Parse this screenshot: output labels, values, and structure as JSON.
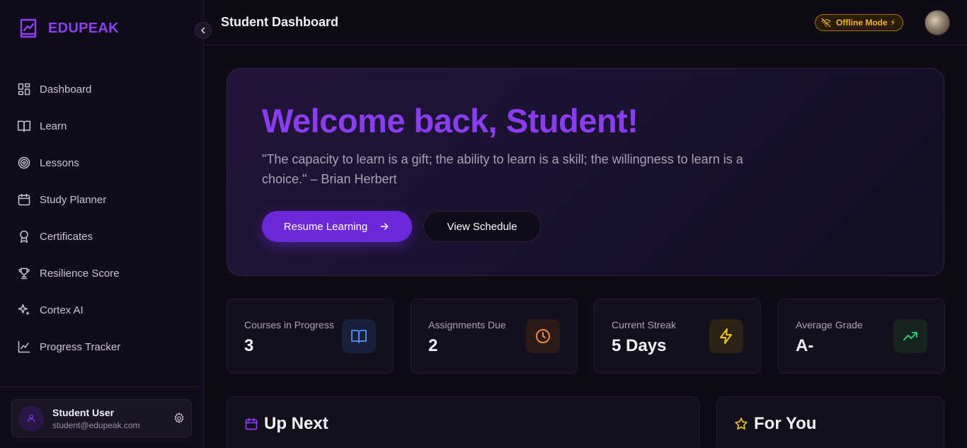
{
  "brand": {
    "name": "EDUPEAK"
  },
  "sidebar": {
    "items": [
      {
        "label": "Dashboard",
        "icon": "layout-dashboard-icon"
      },
      {
        "label": "Learn",
        "icon": "book-open-icon"
      },
      {
        "label": "Lessons",
        "icon": "target-icon"
      },
      {
        "label": "Study Planner",
        "icon": "calendar-icon"
      },
      {
        "label": "Certificates",
        "icon": "award-icon"
      },
      {
        "label": "Resilience Score",
        "icon": "trophy-icon"
      },
      {
        "label": "Cortex AI",
        "icon": "sparkles-icon"
      },
      {
        "label": "Progress Tracker",
        "icon": "line-chart-icon"
      }
    ],
    "user": {
      "name": "Student User",
      "email": "student@edupeak.com"
    }
  },
  "header": {
    "title": "Student Dashboard",
    "offline_label": "Offline Mode ⚡"
  },
  "hero": {
    "title": "Welcome back, Student!",
    "quote": "\"The capacity to learn is a gift; the ability to learn is a skill; the willingness to learn is a choice.\" – Brian Herbert",
    "primary_label": "Resume Learning",
    "secondary_label": "View Schedule"
  },
  "stats": [
    {
      "label": "Courses in Progress",
      "value": "3",
      "icon": "book-open-icon",
      "color": "#5b8ff9"
    },
    {
      "label": "Assignments Due",
      "value": "2",
      "icon": "clock-icon",
      "color": "#f08a3c"
    },
    {
      "label": "Current Streak",
      "value": "5 Days",
      "icon": "zap-icon",
      "color": "#f0c420"
    },
    {
      "label": "Average Grade",
      "value": "A-",
      "icon": "trending-up-icon",
      "color": "#2fc47a"
    }
  ],
  "sections": {
    "up_next": "Up Next",
    "for_you": "For You"
  },
  "colors": {
    "accent": "#8a3df0",
    "primary_button": "#6d28d9",
    "background": "#0e0a16"
  }
}
